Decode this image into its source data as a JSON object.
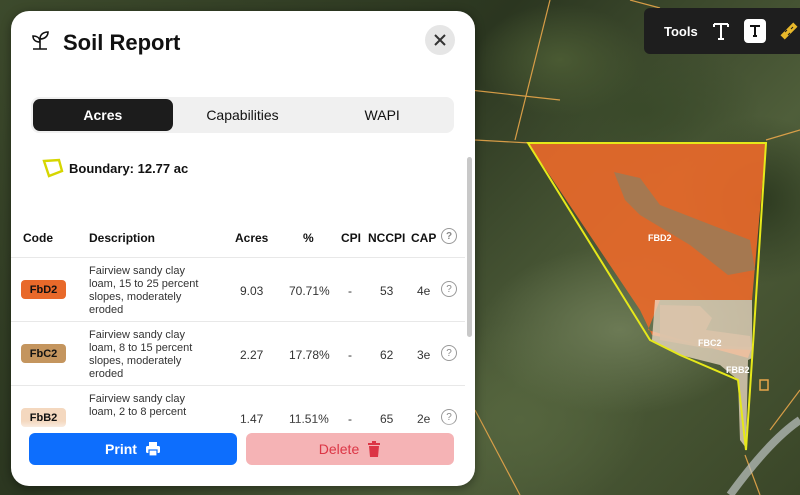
{
  "panel": {
    "title": "Soil Report",
    "tabs": [
      {
        "label": "Acres",
        "active": true
      },
      {
        "label": "Capabilities",
        "active": false
      },
      {
        "label": "WAPI",
        "active": false
      }
    ],
    "boundary_text": "Boundary: 12.77 ac",
    "table": {
      "headers": {
        "code": "Code",
        "description": "Description",
        "acres": "Acres",
        "percent": "%",
        "cpi": "CPI",
        "nccpi": "NCCPI",
        "cap": "CAP"
      },
      "rows": [
        {
          "code": "FbD2",
          "color": "#e8692a",
          "description": "Fairview sandy clay loam, 15 to 25 percent slopes, moderately eroded",
          "acres": "9.03",
          "percent": "70.71%",
          "cpi": "-",
          "nccpi": "53",
          "cap": "4e"
        },
        {
          "code": "FbC2",
          "color": "#c4955e",
          "description": "Fairview sandy clay loam, 8 to 15 percent slopes, moderately eroded",
          "acres": "2.27",
          "percent": "17.78%",
          "cpi": "-",
          "nccpi": "62",
          "cap": "3e"
        },
        {
          "code": "FbB2",
          "color": "#f4d8bf",
          "description": "Fairview sandy clay loam, 2 to 8 percent",
          "acres": "1.47",
          "percent": "11.51%",
          "cpi": "-",
          "nccpi": "65",
          "cap": "2e"
        }
      ]
    },
    "print_label": "Print",
    "delete_label": "Delete"
  },
  "tools": {
    "label": "Tools"
  },
  "map_labels": {
    "fbd2": "FBD2",
    "fbc2": "FBC2",
    "fbb2": "FBB2"
  },
  "colors": {
    "accent_blue": "#0d6efd",
    "boundary": "#e6e81a",
    "delete_red": "#dc3545"
  }
}
